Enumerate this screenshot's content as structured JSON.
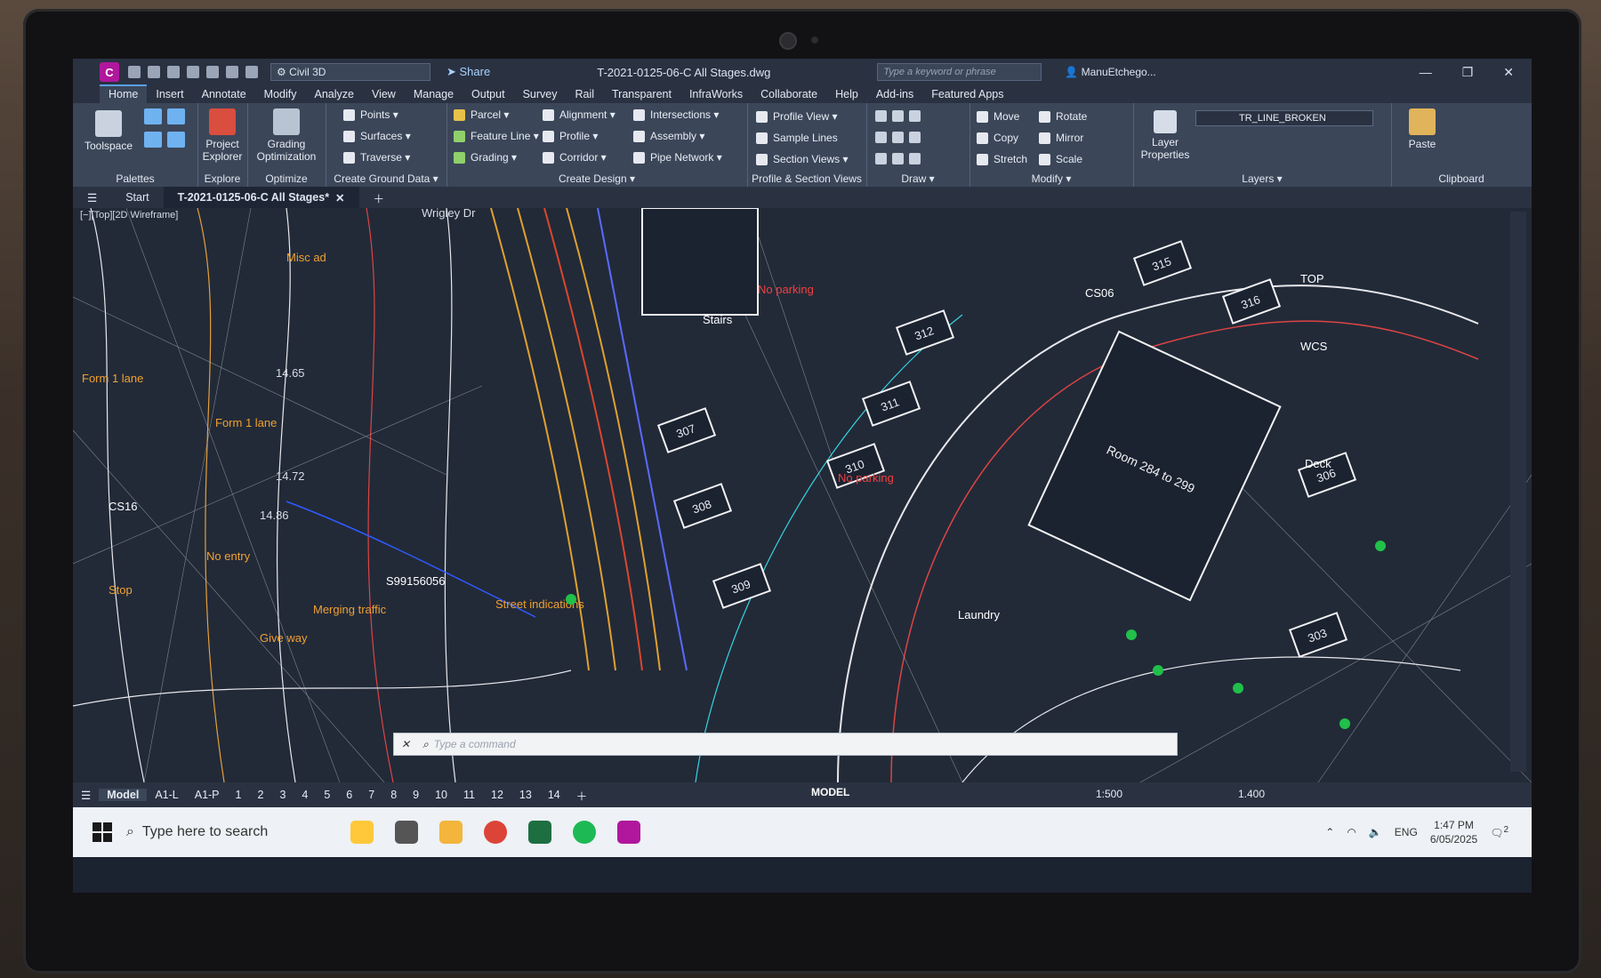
{
  "app": {
    "icon_letter": "C",
    "workspace": "Civil 3D",
    "share_label": "Share",
    "document_title": "T-2021-0125-06-C All Stages.dwg",
    "search_placeholder": "Type a keyword or phrase",
    "user": "ManuEtchego..."
  },
  "ribbon_tabs": [
    "Home",
    "Insert",
    "Annotate",
    "Modify",
    "Analyze",
    "View",
    "Manage",
    "Output",
    "Survey",
    "Rail",
    "Transparent",
    "InfraWorks",
    "Collaborate",
    "Help",
    "Add-ins",
    "Featured Apps"
  ],
  "ribbon": {
    "palettes": {
      "toolspace": "Toolspace",
      "label": "Palettes"
    },
    "explore": {
      "project_explorer": "Project Explorer",
      "label": "Explore"
    },
    "optimize": {
      "grading_optimization": "Grading Optimization",
      "label": "Optimize"
    },
    "ground": {
      "points": "Points",
      "surfaces": "Surfaces",
      "traverse": "Traverse",
      "label": "Create Ground Data"
    },
    "design": {
      "parcel": "Parcel",
      "feature_line": "Feature Line",
      "grading": "Grading",
      "alignment": "Alignment",
      "profile": "Profile",
      "corridor": "Corridor",
      "intersections": "Intersections",
      "assembly": "Assembly",
      "pipe_network": "Pipe Network",
      "label": "Create Design"
    },
    "profile_section": {
      "profile_view": "Profile View",
      "sample_lines": "Sample Lines",
      "section_views": "Section Views",
      "label": "Profile & Section Views"
    },
    "draw": {
      "label": "Draw"
    },
    "modify": {
      "move": "Move",
      "rotate": "Rotate",
      "copy": "Copy",
      "mirror": "Mirror",
      "stretch": "Stretch",
      "scale": "Scale",
      "label": "Modify"
    },
    "layers": {
      "layer_properties": "Layer Properties",
      "current_layer": "TR_LINE_BROKEN",
      "label": "Layers"
    },
    "clipboard": {
      "paste": "Paste",
      "label": "Clipboard"
    }
  },
  "doc_tabs": {
    "start": "Start",
    "active": "T-2021-0125-06-C All Stages*"
  },
  "viewport": {
    "label": "[−][Top][2D Wireframe]"
  },
  "drawing_labels": {
    "lots": [
      "307",
      "308",
      "309",
      "310",
      "311",
      "312",
      "315",
      "316",
      "306",
      "303"
    ],
    "room": "Room 284 to 299",
    "texts": [
      "Misc ad",
      "Form 1 lane",
      "Form 1 lane",
      "14.65",
      "14.72",
      "14.86",
      "CS16",
      "Stop",
      "No entry",
      "Give way",
      "Merging traffic",
      "S99156056",
      "Street indications",
      "No parking",
      "No parking",
      "CS06",
      "Stairs",
      "Laundry",
      "Deck",
      "Wrigley Dr",
      "TOP",
      "WCS"
    ]
  },
  "command": {
    "placeholder": "Type a command"
  },
  "status": {
    "layout_tabs": [
      "Model",
      "A1-L",
      "A1-P",
      "1",
      "2",
      "3",
      "4",
      "5",
      "6",
      "7",
      "8",
      "9",
      "10",
      "11",
      "12",
      "13",
      "14"
    ],
    "model_button": "MODEL",
    "scale": "1:500",
    "lineweight": "1.400"
  },
  "taskbar": {
    "search_placeholder": "Type here to search",
    "language": "ENG",
    "time": "1:47 PM",
    "date": "6/05/2025",
    "notifications": "2"
  }
}
